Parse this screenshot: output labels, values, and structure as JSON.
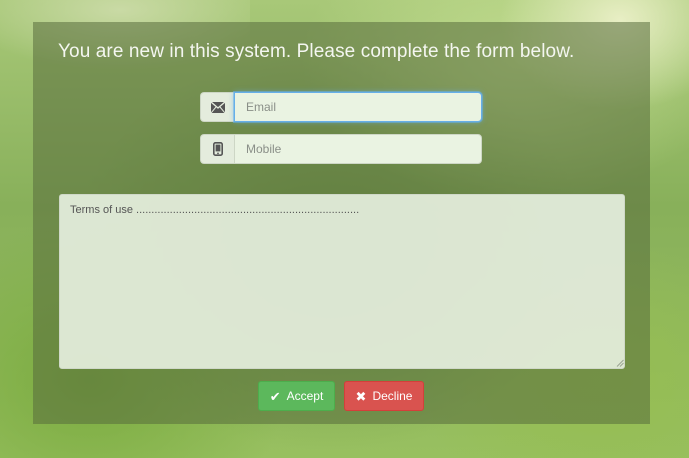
{
  "form": {
    "title": "You are new in this system. Please complete the form below.",
    "email": {
      "icon": "envelope-icon",
      "placeholder": "Email",
      "value": ""
    },
    "mobile": {
      "icon": "mobile-phone-icon",
      "placeholder": "Mobile",
      "value": ""
    },
    "terms_text": "Terms of use .........................................................................",
    "accept": {
      "icon": "checkmark-icon",
      "label": "Accept",
      "color": "#5cb85c"
    },
    "decline": {
      "icon": "x-icon",
      "label": "Decline",
      "color": "#d9534f"
    }
  }
}
